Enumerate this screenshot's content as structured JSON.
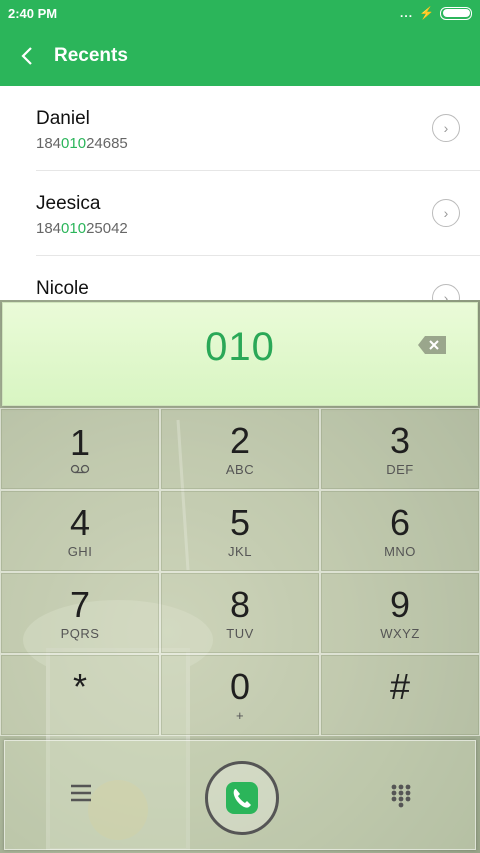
{
  "status": {
    "time": "2:40 PM",
    "dots": "...",
    "bolt": "⚡"
  },
  "header": {
    "title": "Recents"
  },
  "recents": [
    {
      "name": "Daniel",
      "number_prefix": "184",
      "number_match": "010",
      "number_suffix": "24685"
    },
    {
      "name": "Jeesica",
      "number_prefix": "184",
      "number_match": "010",
      "number_suffix": "25042"
    },
    {
      "name": "Nicole",
      "number_prefix": "",
      "number_match": "",
      "number_suffix": ""
    }
  ],
  "dial": {
    "digits": "010"
  },
  "keys": [
    {
      "digit": "1",
      "letters": ""
    },
    {
      "digit": "2",
      "letters": "ABC"
    },
    {
      "digit": "3",
      "letters": "DEF"
    },
    {
      "digit": "4",
      "letters": "GHI"
    },
    {
      "digit": "5",
      "letters": "JKL"
    },
    {
      "digit": "6",
      "letters": "MNO"
    },
    {
      "digit": "7",
      "letters": "PQRS"
    },
    {
      "digit": "8",
      "letters": "TUV"
    },
    {
      "digit": "9",
      "letters": "WXYZ"
    },
    {
      "digit": "*",
      "letters": ""
    },
    {
      "digit": "0",
      "letters": "+"
    },
    {
      "digit": "#",
      "letters": ""
    }
  ],
  "colors": {
    "accent": "#2bb55a",
    "display_bg": "#e3f8cf"
  },
  "icons": [
    "back-icon",
    "chevron-right-icon",
    "backspace-icon",
    "voicemail-icon",
    "menu-icon",
    "phone-icon",
    "dialpad-icon",
    "battery-icon"
  ]
}
